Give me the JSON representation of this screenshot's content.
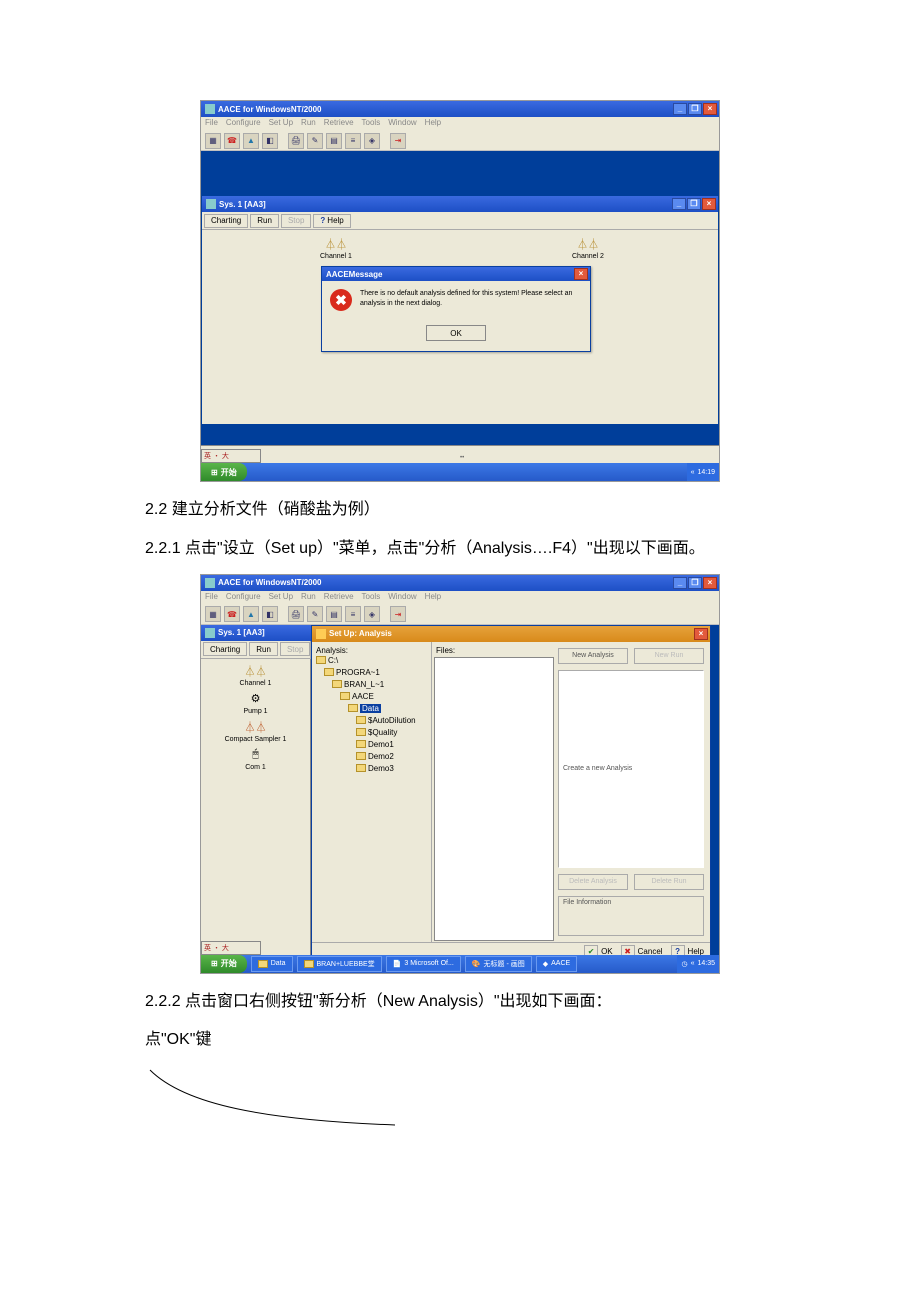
{
  "app": {
    "title": "AACE for WindowsNT/2000",
    "menus": [
      "File",
      "Configure",
      "Set Up",
      "Run",
      "Retrieve",
      "Tools",
      "Window",
      "Help"
    ]
  },
  "subwin": {
    "title": "Sys. 1 [AA3]",
    "tabs": {
      "charting": "Charting",
      "run": "Run",
      "stop": "Stop",
      "help": "Help"
    }
  },
  "dev": {
    "ch1": "Channel 1",
    "ch2": "Channel 2",
    "pump": "Pump 1",
    "sampler": "Compact Sampler 1",
    "com": "Com 1"
  },
  "msg": {
    "title": "AACEMessage",
    "text": "There is no default analysis defined for this system! Please select an analysis in the next dialog.",
    "ok": "OK"
  },
  "ime": "英 ・ 大",
  "start": "开始",
  "clock1": "14:19",
  "clock2": "14:35",
  "para_22": "2.2 建立分析文件（硝酸盐为例）",
  "para_221": "2.2.1 点击\"设立（Set up）\"菜单，点击\"分析（Analysis….F4）\"出现以下画面。",
  "setup": {
    "title": "Set Up: Analysis",
    "analysis_h": "Analysis:",
    "files_h": "Files:",
    "tree": {
      "c": "C:\\",
      "progra": "PROGRA~1",
      "bran": "BRAN_L~1",
      "aace": "AACE",
      "data": "Data",
      "autod": "$AutoDilution",
      "qual": "$Quality",
      "d1": "Demo1",
      "d2": "Demo2",
      "d3": "Demo3"
    },
    "btns": {
      "newa": "New Analysis",
      "newr": "New Run",
      "create": "Create a new Analysis",
      "dela": "Delete Analysis",
      "delr": "Delete Run",
      "fi": "File Information"
    },
    "bottom": {
      "ok": "OK",
      "cancel": "Cancel",
      "help": "Help"
    }
  },
  "task2": {
    "data": "Data",
    "bran": "BRAN+LUEBBE堂",
    "ms": "3 Microsoft Of...",
    "pic": "无标题 - 画图",
    "aace": "AACE"
  },
  "para_222": "2.2.2 点击窗口右侧按钮\"新分析（New Analysis）\"出现如下画面：",
  "para_ok": "点\"OK\"键"
}
